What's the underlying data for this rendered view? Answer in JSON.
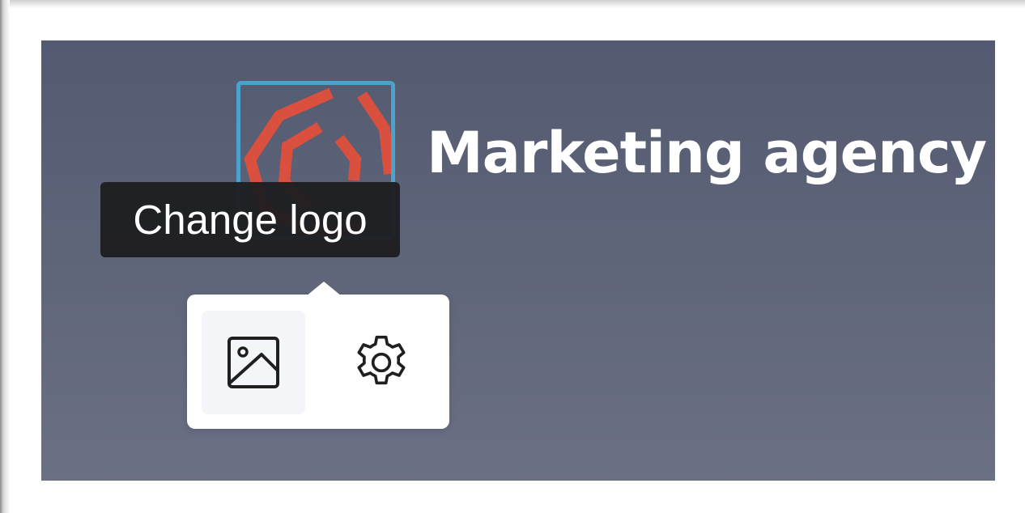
{
  "banner": {
    "brand_title": "Marketing agency",
    "background_top": "#535a71",
    "background_bottom": "#6b7085"
  },
  "logo": {
    "frame_color": "#4aa3cc",
    "mark_color": "#d9503e",
    "icon": "hexagon-logo"
  },
  "tooltip": {
    "text": "Change logo"
  },
  "popover": {
    "buttons": [
      {
        "icon": "image-icon",
        "state": "hovered"
      },
      {
        "icon": "gear-icon"
      }
    ]
  }
}
